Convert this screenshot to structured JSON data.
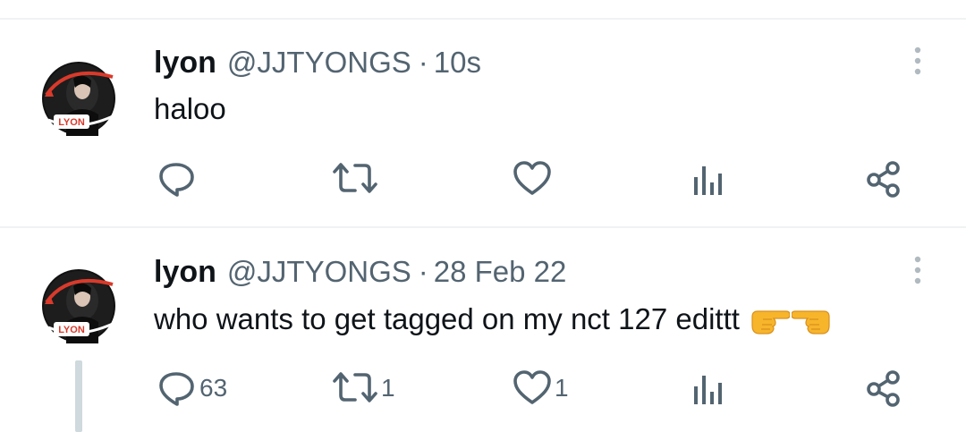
{
  "tweets": [
    {
      "display_name": "lyon",
      "handle": "@JJTYONGS",
      "separator": "·",
      "time": "10s",
      "text": "haloo",
      "avatar_label": "LYON",
      "reply_count": "",
      "retweet_count": "",
      "like_count": ""
    },
    {
      "display_name": "lyon",
      "handle": "@JJTYONGS",
      "separator": "·",
      "time": "28 Feb 22",
      "text": "who wants to get tagged on my nct 127 edittt",
      "avatar_label": "LYON",
      "emoji": [
        "pointing-right-emoji",
        "pointing-left-emoji"
      ],
      "reply_count": "63",
      "retweet_count": "1",
      "like_count": "1"
    }
  ],
  "colors": {
    "text_primary": "#0f1419",
    "text_secondary": "#536471",
    "divider": "#eff3f4",
    "thread_line": "#cfd9de",
    "avatar_accent": "#d93a2b",
    "emoji_yellow": "#f7b52c"
  },
  "icons": [
    "reply-icon",
    "retweet-icon",
    "like-icon",
    "views-icon",
    "share-icon",
    "more-options-icon"
  ]
}
